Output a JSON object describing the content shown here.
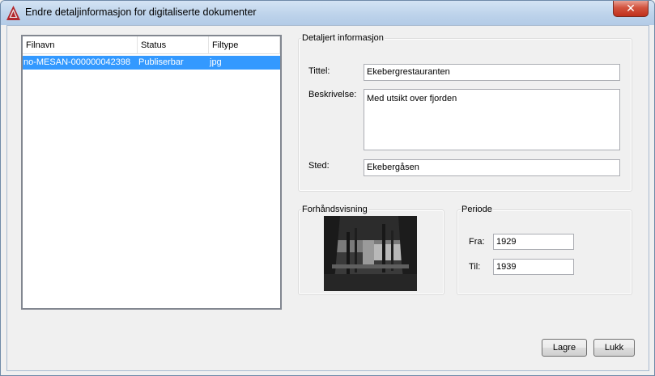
{
  "window": {
    "title": "Endre detaljinformasjon for digitaliserte dokumenter",
    "close_symbol": "✕",
    "app_icon": "autocad-icon"
  },
  "file_list": {
    "columns": [
      "Filnavn",
      "Status",
      "Filtype"
    ],
    "rows": [
      {
        "filename": "no-MESAN-000000042398",
        "status": "Publiserbar",
        "filetype": "jpg"
      }
    ]
  },
  "details": {
    "group_label": "Detaljert informasjon",
    "title_label": "Tittel:",
    "title_value": "Ekebergrestauranten",
    "description_label": "Beskrivelse:",
    "description_value": "Med utsikt over fjorden",
    "place_label": "Sted:",
    "place_value": "Ekebergåsen"
  },
  "preview": {
    "group_label": "Forhåndsvisning",
    "image": "black-and-white-photo"
  },
  "period": {
    "group_label": "Periode",
    "from_label": "Fra:",
    "from_value": "1929",
    "to_label": "Til:",
    "to_value": "1939"
  },
  "buttons": {
    "save_label": "Lagre",
    "close_label": "Lukk"
  },
  "colors": {
    "selection": "#3399ff",
    "close_button": "#c7432c"
  }
}
